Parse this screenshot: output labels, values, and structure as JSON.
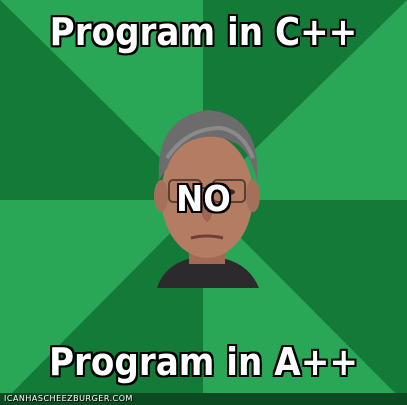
{
  "meme": {
    "top_text": "Program in C++",
    "middle_text": "NO",
    "bottom_text": "Program in A++",
    "watermark": "ICANHASCHEEZBURGER.COM"
  },
  "colors": {
    "wedge_light": "#2aa657",
    "wedge_dark": "#137a38",
    "skin": "#b47c63",
    "hair": "#6c6c6c",
    "shirt": "#2d2a2d"
  }
}
